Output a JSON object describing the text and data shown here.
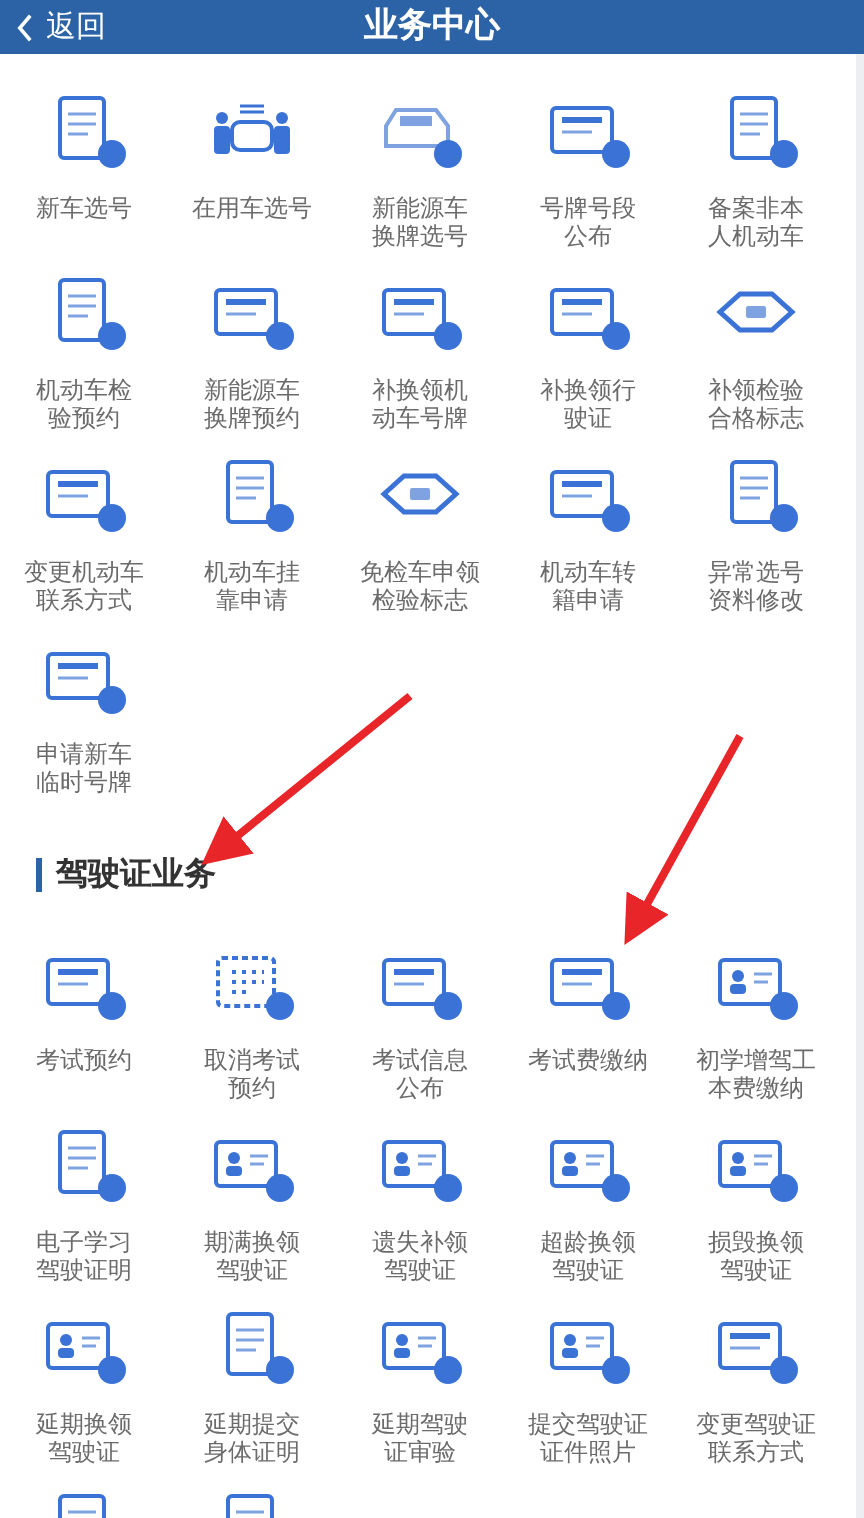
{
  "header": {
    "back": "返回",
    "title": "业务中心"
  },
  "vehicle_items": [
    {
      "kind": "service",
      "label": "新车选号"
    },
    {
      "kind": "service",
      "label": "在用车选号"
    },
    {
      "kind": "service",
      "label": "新能源车换牌选号"
    },
    {
      "kind": "service",
      "label": "号牌号段公布"
    },
    {
      "kind": "service",
      "label": "备案非本人机动车"
    },
    {
      "kind": "service",
      "label": "机动车检验预约"
    },
    {
      "kind": "service",
      "label": "新能源车换牌预约"
    },
    {
      "kind": "service",
      "label": "补换领机动车号牌"
    },
    {
      "kind": "service",
      "label": "补换领行驶证"
    },
    {
      "kind": "service",
      "label": "补领检验合格标志"
    },
    {
      "kind": "service",
      "label": "变更机动车联系方式"
    },
    {
      "kind": "service",
      "label": "机动车挂靠申请"
    },
    {
      "kind": "service",
      "label": "免检车申领检验标志"
    },
    {
      "kind": "service",
      "label": "机动车转籍申请"
    },
    {
      "kind": "service",
      "label": "异常选号资料修改"
    },
    {
      "kind": "service",
      "label": "申请新车临时号牌"
    }
  ],
  "section": {
    "title": "驾驶证业务"
  },
  "license_items": [
    {
      "kind": "service",
      "label": "考试预约"
    },
    {
      "kind": "service",
      "label": "取消考试预约"
    },
    {
      "kind": "service",
      "label": "考试信息公布"
    },
    {
      "kind": "service",
      "label": "考试费缴纳"
    },
    {
      "kind": "service",
      "label": "初学增驾工本费缴纳"
    },
    {
      "kind": "service",
      "label": "电子学习驾驶证明"
    },
    {
      "kind": "service",
      "label": "期满换领驾驶证"
    },
    {
      "kind": "service",
      "label": "遗失补领驾驶证"
    },
    {
      "kind": "service",
      "label": "超龄换领驾驶证"
    },
    {
      "kind": "service",
      "label": "损毁换领驾驶证"
    },
    {
      "kind": "service",
      "label": "延期换领驾驶证"
    },
    {
      "kind": "service",
      "label": "延期提交身体证明"
    },
    {
      "kind": "service",
      "label": "延期驾驶证审验"
    },
    {
      "kind": "service",
      "label": "提交驾驶证证件照片"
    },
    {
      "kind": "service",
      "label": "变更驾驶证联系方式"
    },
    {
      "kind": "icon_only"
    },
    {
      "kind": "icon_only"
    }
  ]
}
